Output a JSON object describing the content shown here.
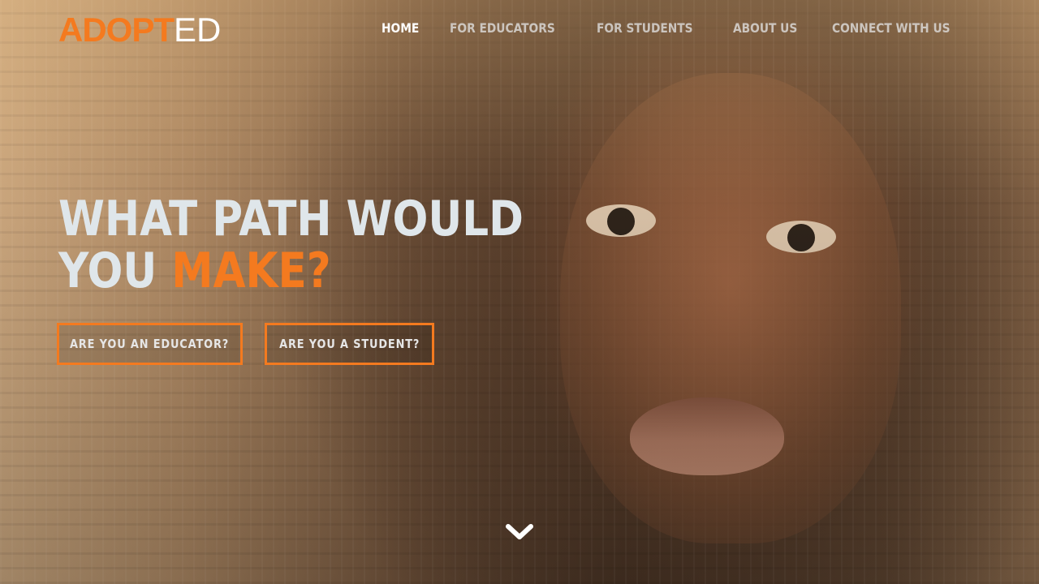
{
  "brand": {
    "logo_part1": "ADOPT",
    "logo_part2": "ED",
    "accent_color": "#f47a1f"
  },
  "nav": {
    "items": [
      {
        "label": "HOME",
        "active": true
      },
      {
        "label": "FOR EDUCATORS",
        "active": false
      },
      {
        "label": "FOR STUDENTS",
        "active": false
      },
      {
        "label": "ABOUT US",
        "active": false
      },
      {
        "label": "CONNECT WITH US",
        "active": false
      }
    ]
  },
  "hero": {
    "line1": "WHAT PATH WOULD",
    "line2_prefix": "YOU ",
    "line2_accent": "MAKE?",
    "cta_educator": "ARE YOU AN EDUCATOR?",
    "cta_student": "ARE YOU A STUDENT?",
    "scroll_icon": "chevron-down-icon"
  }
}
